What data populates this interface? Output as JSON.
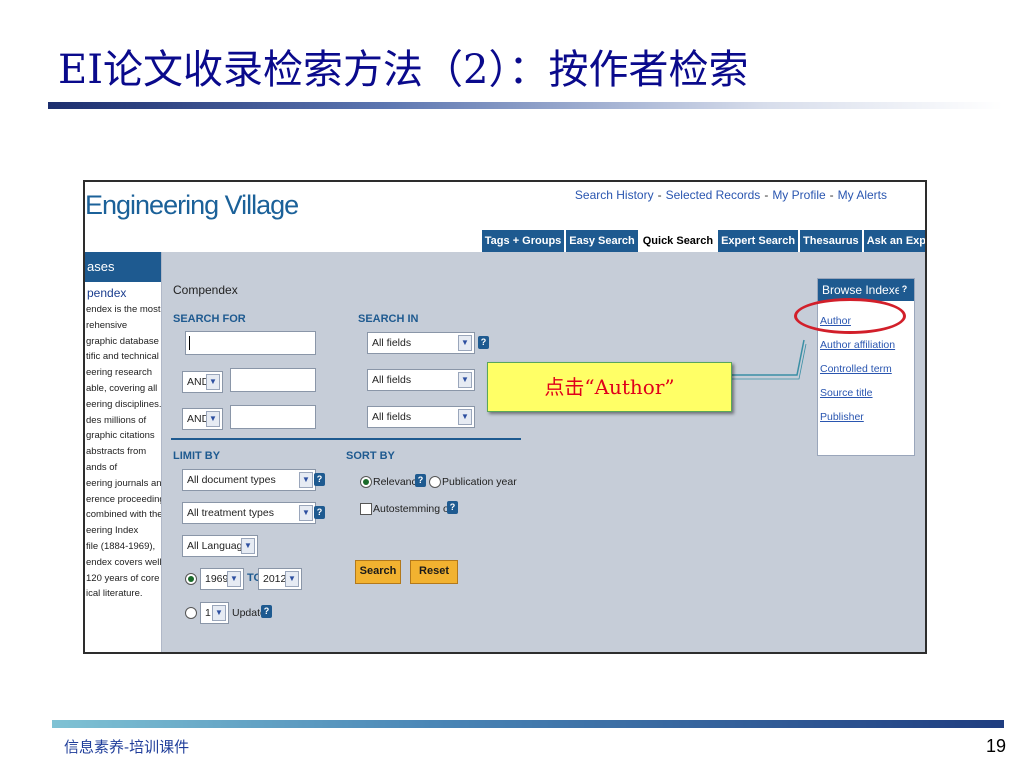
{
  "slide": {
    "title": "EI论文收录检索方法（2）：按作者检索",
    "footer": "信息素养-培训课件",
    "page_number": "19"
  },
  "callout": {
    "text": "点击“Author”",
    "color": "#e0001b",
    "background": "#ffff66"
  },
  "screenshot": {
    "logo": "Engineering Village",
    "top_links": [
      "Search History",
      "Selected Records",
      "My Profile",
      "My Alerts"
    ],
    "top_link_separator": "-",
    "tabs": [
      "Tags + Groups",
      "Easy Search",
      "Quick Search",
      "Expert Search",
      "Thesaurus",
      "Ask an Exp"
    ],
    "active_tab": "Quick Search",
    "db_panel": {
      "heading": "ases",
      "db_name": "pendex",
      "description": [
        "endex is the most",
        "rehensive",
        "graphic database of",
        "tific and technical",
        "eering research",
        "able, covering all",
        "eering disciplines. It",
        "des millions of",
        "graphic citations",
        "abstracts from",
        "ands of",
        "eering journals and",
        "erence proceedings.",
        "combined with the",
        "eering Index",
        "file (1884-1969),",
        "endex covers well",
        "120 years of core",
        "ical literature."
      ]
    },
    "form": {
      "database": "Compendex",
      "search_for_label": "SEARCH FOR",
      "search_in_label": "SEARCH IN",
      "search_values": [
        "",
        "",
        ""
      ],
      "connectors": [
        "AND",
        "AND"
      ],
      "fields": [
        "All fields",
        "All fields",
        "All fields"
      ],
      "limit_by_label": "LIMIT BY",
      "document_type": "All document types",
      "treatment_type": "All treatment types",
      "language": "All Languages",
      "year_from": "1969",
      "year_to_label": "TO",
      "year_to": "2012",
      "updates_value": "1",
      "updates_label": "Updates",
      "sort_by_label": "SORT BY",
      "sort_relevance": "Relevance",
      "sort_pubyear": "Publication year",
      "autostemming": "Autostemming off",
      "search_button": "Search",
      "reset_button": "Reset",
      "help_glyph": "?",
      "dropdown_glyph": "▼"
    },
    "browse_indexes": {
      "heading": "Browse Indexes",
      "links": [
        "Author",
        "Author affiliation",
        "Controlled term",
        "Source title",
        "Publisher"
      ]
    }
  },
  "colors": {
    "title": "#0a0a8c",
    "ev_blue": "#1e5a90",
    "link": "#2a56b0",
    "button": "#f2b230",
    "highlight": "#d21f2a"
  }
}
